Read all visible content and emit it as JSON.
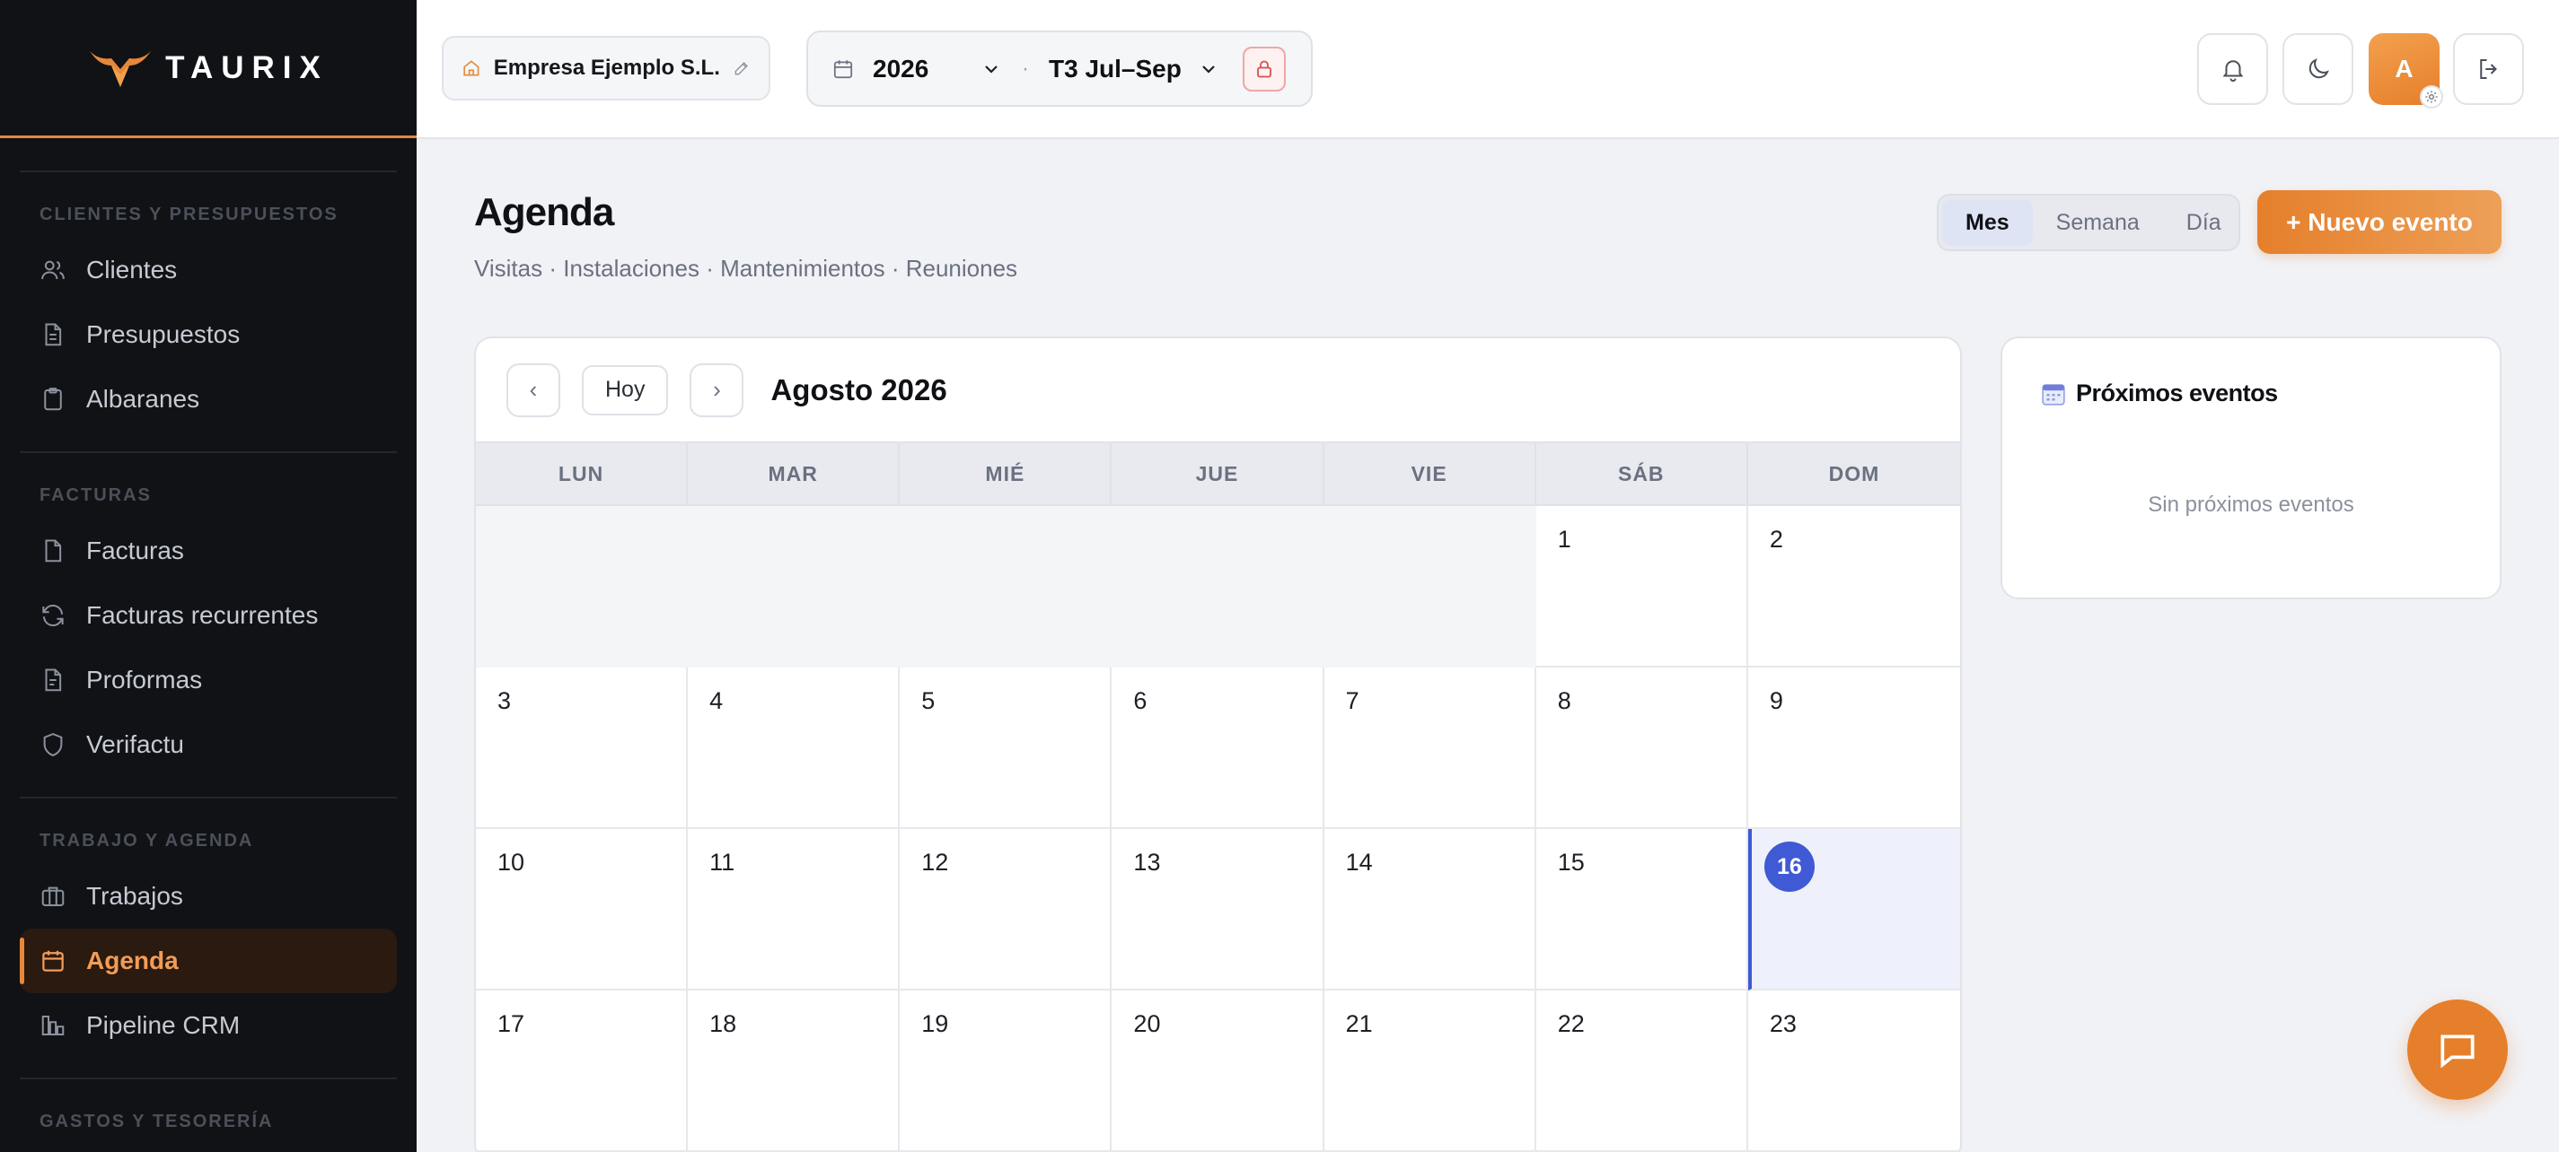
{
  "app": {
    "brand": "TAURIX",
    "accent": "#e6883a"
  },
  "sidebar": {
    "sections": [
      {
        "title": "CLIENTES Y PRESUPUESTOS",
        "items": [
          {
            "label": "Clientes",
            "icon": "users-icon"
          },
          {
            "label": "Presupuestos",
            "icon": "file-icon"
          },
          {
            "label": "Albaranes",
            "icon": "clipboard-icon"
          }
        ]
      },
      {
        "title": "FACTURAS",
        "items": [
          {
            "label": "Facturas",
            "icon": "file-icon"
          },
          {
            "label": "Facturas recurrentes",
            "icon": "refresh-icon"
          },
          {
            "label": "Proformas",
            "icon": "file-icon"
          },
          {
            "label": "Verifactu",
            "icon": "shield-icon"
          }
        ]
      },
      {
        "title": "TRABAJO Y AGENDA",
        "items": [
          {
            "label": "Trabajos",
            "icon": "briefcase-icon"
          },
          {
            "label": "Agenda",
            "icon": "calendar-icon",
            "active": true
          },
          {
            "label": "Pipeline CRM",
            "icon": "chart-icon"
          }
        ]
      },
      {
        "title": "GASTOS Y TESORERÍA",
        "items": []
      }
    ]
  },
  "topbar": {
    "company": "Empresa Ejemplo S.L.",
    "year": "2026",
    "quarter": "T3 Jul–Sep",
    "avatar_initial": "A"
  },
  "page": {
    "title": "Agenda",
    "subtitle": "Visitas · Instalaciones · Mantenimientos · Reuniones",
    "views": [
      "Mes",
      "Semana",
      "Día"
    ],
    "active_view": "Mes",
    "new_event_label": "+ Nuevo evento"
  },
  "calendar": {
    "prev": "‹",
    "today_label": "Hoy",
    "next": "›",
    "month_title": "Agosto 2026",
    "weekdays": [
      "LUN",
      "MAR",
      "MIÉ",
      "JUE",
      "VIE",
      "SÁB",
      "DOM"
    ],
    "leading_empty": 5,
    "today": 16,
    "days": [
      "1",
      "2",
      "3",
      "4",
      "5",
      "6",
      "7",
      "8",
      "9",
      "10",
      "11",
      "12",
      "13",
      "14",
      "15",
      "16",
      "17",
      "18",
      "19",
      "20",
      "21",
      "22",
      "23"
    ]
  },
  "upcoming": {
    "title": "Próximos eventos",
    "empty_text": "Sin próximos eventos"
  }
}
